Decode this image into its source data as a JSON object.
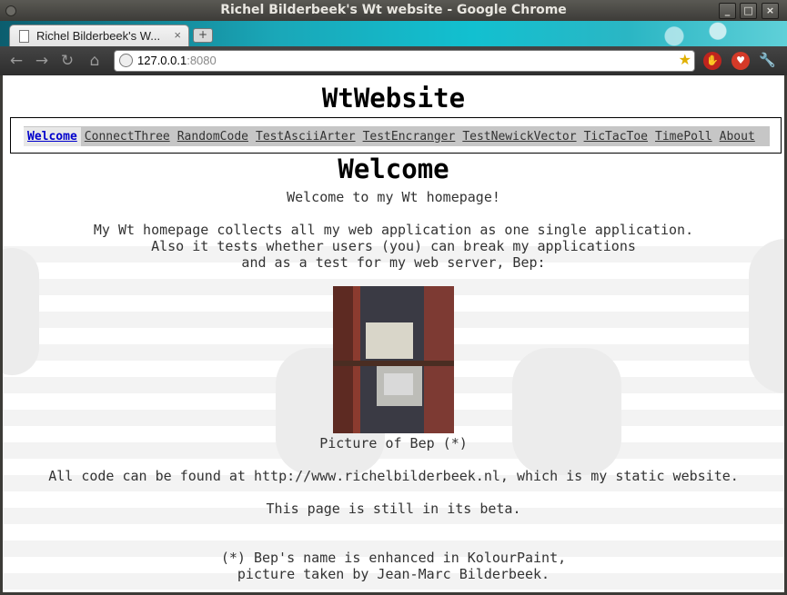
{
  "window": {
    "title": "Richel Bilderbeek's Wt website - Google Chrome"
  },
  "tab": {
    "title": "Richel Bilderbeek's W...",
    "close_glyph": "×",
    "new_tab_glyph": "+"
  },
  "toolbar": {
    "back_icon": "arrow-left-icon",
    "forward_icon": "arrow-right-icon",
    "reload_icon": "reload-icon",
    "home_icon": "home-icon",
    "url_host": "127.0.0.1",
    "url_port": ":8080",
    "extensions": [
      "stop-sign-extension-icon",
      "shield-extension-icon"
    ]
  },
  "page": {
    "site_title": "WtWebsite",
    "menu": [
      "Welcome",
      "ConnectThree",
      "RandomCode",
      "TestAsciiArter",
      "TestEncranger",
      "TestNewickVector",
      "TicTacToe",
      "TimePoll",
      "About"
    ],
    "active_menu": "Welcome",
    "heading": "Welcome",
    "intro": "Welcome to my Wt homepage!",
    "para1": "My Wt homepage collects all my web application as one single application.",
    "para2": "Also it tests whether users (you) can break my applications",
    "para3": "and as a test for my web server, Bep:",
    "caption": "Picture of Bep (*)",
    "code_line": "All code can be found at http://www.richelbilderbeek.nl, which is my static website.",
    "beta_line": "This page is still in its beta.",
    "footnote1": "(*) Bep's name is enhanced in KolourPaint,",
    "footnote2": "picture taken by Jean-Marc Bilderbeek."
  },
  "colors": {
    "active_link": "#0000cc",
    "menu_bg": "#c6c6c6",
    "tab_strip": "#1aa7b8"
  }
}
